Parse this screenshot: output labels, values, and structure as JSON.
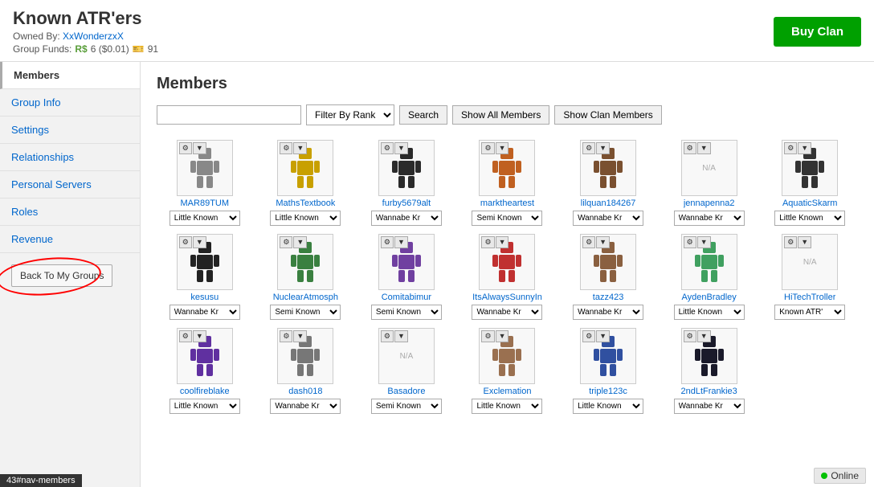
{
  "header": {
    "title": "Known ATR'ers",
    "owned_by_label": "Owned By:",
    "owner_name": "XxWonderzxX",
    "group_funds_label": "Group Funds:",
    "robux_amount": "R$6 ($0.01)",
    "ticket_amount": "91",
    "buy_clan_label": "Buy Clan"
  },
  "sidebar": {
    "items": [
      {
        "label": "Members",
        "active": true,
        "name": "members"
      },
      {
        "label": "Group Info",
        "active": false,
        "name": "group-info"
      },
      {
        "label": "Settings",
        "active": false,
        "name": "settings"
      },
      {
        "label": "Relationships",
        "active": false,
        "name": "relationships"
      },
      {
        "label": "Personal Servers",
        "active": false,
        "name": "personal-servers"
      },
      {
        "label": "Roles",
        "active": false,
        "name": "roles"
      },
      {
        "label": "Revenue",
        "active": false,
        "name": "revenue"
      }
    ],
    "back_button_label": "Back To My Groups"
  },
  "content": {
    "title": "Members",
    "filter": {
      "placeholder": "",
      "select_default": "Filter By Rank",
      "search_label": "Search",
      "show_all_label": "Show All Members",
      "show_clan_label": "Show Clan Members"
    },
    "members": [
      {
        "name": "MAR89TUM",
        "rank": "Little Known",
        "avatar_color": "gray"
      },
      {
        "name": "MathsTextbook",
        "rank": "Little Known",
        "avatar_color": "orange"
      },
      {
        "name": "furby5679alt",
        "rank": "Wannabe Kr",
        "avatar_color": "dark"
      },
      {
        "name": "marktheartest",
        "rank": "Semi Known",
        "avatar_color": "orange2"
      },
      {
        "name": "lilquan184267",
        "rank": "Wannabe Kr",
        "avatar_color": "brown"
      },
      {
        "name": "jennapenna2",
        "rank": "Wannabe Kr",
        "avatar_color": "na"
      },
      {
        "name": "AquaticSkarm",
        "rank": "Little Known",
        "avatar_color": "dark2"
      },
      {
        "name": "kesusu",
        "rank": "Wannabe Kr",
        "avatar_color": "dark3"
      },
      {
        "name": "NuclearAtmosph",
        "rank": "Semi Known",
        "avatar_color": "green"
      },
      {
        "name": "Comitabimur",
        "rank": "Semi Known",
        "avatar_color": "purple"
      },
      {
        "name": "ItsAlwaysSunnyIn",
        "rank": "Wannabe Kr",
        "avatar_color": "red"
      },
      {
        "name": "tazz423",
        "rank": "Wannabe Kr",
        "avatar_color": "brown2"
      },
      {
        "name": "AydenBradley",
        "rank": "Little Known",
        "avatar_color": "green2"
      },
      {
        "name": "HiTechTroller",
        "rank": "Known ATR'",
        "avatar_color": "na2"
      },
      {
        "name": "coolfireblake",
        "rank": "Little Known",
        "avatar_color": "purple2"
      },
      {
        "name": "dash018",
        "rank": "Wannabe Kr",
        "avatar_color": "gray2"
      },
      {
        "name": "Basadore",
        "rank": "Semi Known",
        "avatar_color": "na3"
      },
      {
        "name": "Exclemation",
        "rank": "Little Known",
        "avatar_color": "brown3"
      },
      {
        "name": "triple123c",
        "rank": "Little Known",
        "avatar_color": "blue"
      },
      {
        "name": "2ndLtFrankie3",
        "rank": "Wannabe Kr",
        "avatar_color": "dark4"
      }
    ],
    "rank_options": [
      "Little Known",
      "Semi Known",
      "Wannabe Kr",
      "Known ATR'",
      "Filter By Rank"
    ]
  },
  "statusbar": {
    "url_fragment": "43#nav-members"
  },
  "online": {
    "label": "Online"
  }
}
